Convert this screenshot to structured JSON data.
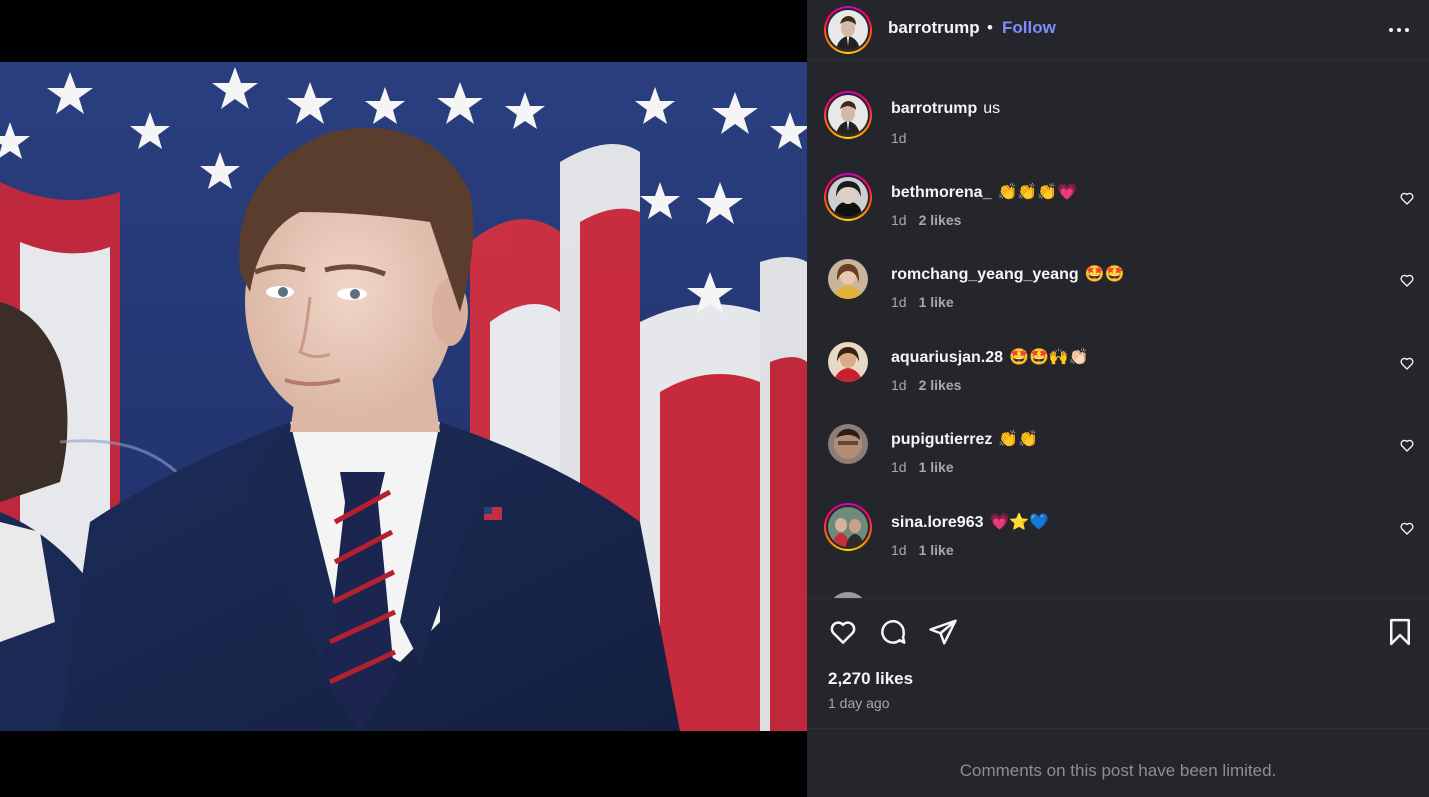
{
  "post": {
    "author": "barrotrump",
    "separator": "•",
    "follow_label": "Follow",
    "caption_text": "us",
    "caption_time": "1d"
  },
  "comments": [
    {
      "username": "bethmorena_",
      "text": "👏👏👏💗",
      "time": "1d",
      "likes": "2 likes"
    },
    {
      "username": "romchang_yeang_yeang",
      "text": "🤩🤩",
      "time": "1d",
      "likes": "1 like"
    },
    {
      "username": "aquariusjan.28",
      "text": "🤩🤩🙌👏🏻",
      "time": "1d",
      "likes": "2 likes"
    },
    {
      "username": "pupigutierrez",
      "text": "👏👏",
      "time": "1d",
      "likes": "1 like"
    },
    {
      "username": "sina.lore963",
      "text": "💗⭐💙",
      "time": "1d",
      "likes": "1 like"
    }
  ],
  "actions": {
    "like_icon": "heart-icon",
    "comment_icon": "comment-bubble-icon",
    "share_icon": "paper-plane-icon",
    "save_icon": "bookmark-icon"
  },
  "likes_count": "2,270 likes",
  "time_ago": "1 day ago",
  "comments_limited": "Comments on this post have been limited.",
  "colors": {
    "panel_bg": "#25262b",
    "follow_blue": "#7d8cff",
    "muted_text": "#a8a8a8"
  }
}
